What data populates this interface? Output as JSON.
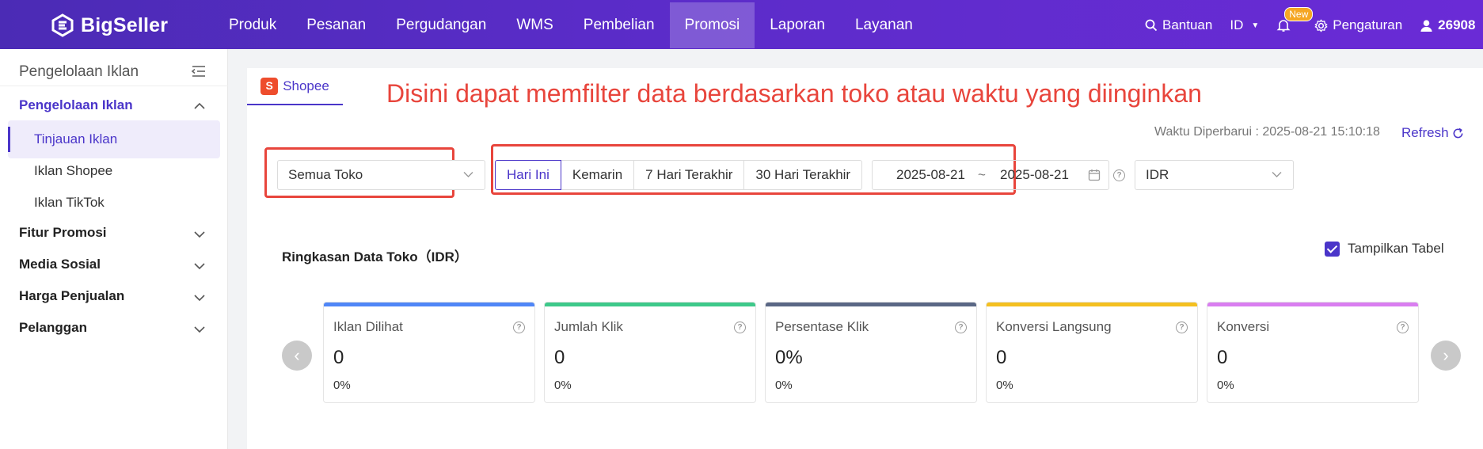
{
  "topbar": {
    "brand": "BigSeller",
    "nav": [
      {
        "label": "Produk",
        "active": false
      },
      {
        "label": "Pesanan",
        "active": false
      },
      {
        "label": "Pergudangan",
        "active": false
      },
      {
        "label": "WMS",
        "active": false
      },
      {
        "label": "Pembelian",
        "active": false
      },
      {
        "label": "Promosi",
        "active": true
      },
      {
        "label": "Laporan",
        "active": false
      },
      {
        "label": "Layanan",
        "active": false
      }
    ],
    "help_label": "Bantuan",
    "lang_label": "ID",
    "new_badge": "New",
    "settings_label": "Pengaturan",
    "user_label": "26908"
  },
  "sidebar": {
    "title": "Pengelolaan Iklan",
    "groups": [
      {
        "label": "Pengelolaan Iklan",
        "expanded": true
      },
      {
        "label": "Fitur Promosi",
        "expanded": false
      },
      {
        "label": "Media Sosial",
        "expanded": false
      },
      {
        "label": "Harga Penjualan",
        "expanded": false
      },
      {
        "label": "Pelanggan",
        "expanded": false
      }
    ],
    "items": [
      {
        "label": "Tinjauan Iklan",
        "active": true
      },
      {
        "label": "Iklan Shopee",
        "active": false
      },
      {
        "label": "Iklan TikTok",
        "active": false
      }
    ]
  },
  "main": {
    "tab_label": "Shopee",
    "annotation": "Disini dapat memfilter data berdasarkan toko atau waktu yang diinginkan",
    "updated_label": "Waktu Diperbarui : 2025-08-21 15:10:18",
    "refresh_label": "Refresh",
    "store_select": "Semua Toko",
    "time_ranges": [
      "Hari Ini",
      "Kemarin",
      "7 Hari Terakhir",
      "30 Hari Terakhir"
    ],
    "date_start": "2025-08-21",
    "date_separator": "~",
    "date_end": "2025-08-21",
    "currency_select": "IDR",
    "summary_title": "Ringkasan Data Toko（IDR）",
    "show_table_label": "Tampilkan Tabel",
    "cards": [
      {
        "label": "Iklan Dilihat",
        "value": "0",
        "pct": "0%",
        "color": "#4f86f7"
      },
      {
        "label": "Jumlah Klik",
        "value": "0",
        "pct": "0%",
        "color": "#3ec98a"
      },
      {
        "label": "Persentase Klik",
        "value": "0%",
        "pct": "0%",
        "color": "#5a6785"
      },
      {
        "label": "Konversi Langsung",
        "value": "0",
        "pct": "0%",
        "color": "#f4c020"
      },
      {
        "label": "Konversi",
        "value": "0",
        "pct": "0%",
        "color": "#d97ef0"
      }
    ]
  },
  "colors": {
    "accent": "#4a35c9",
    "annotation_red": "#e8453c"
  }
}
